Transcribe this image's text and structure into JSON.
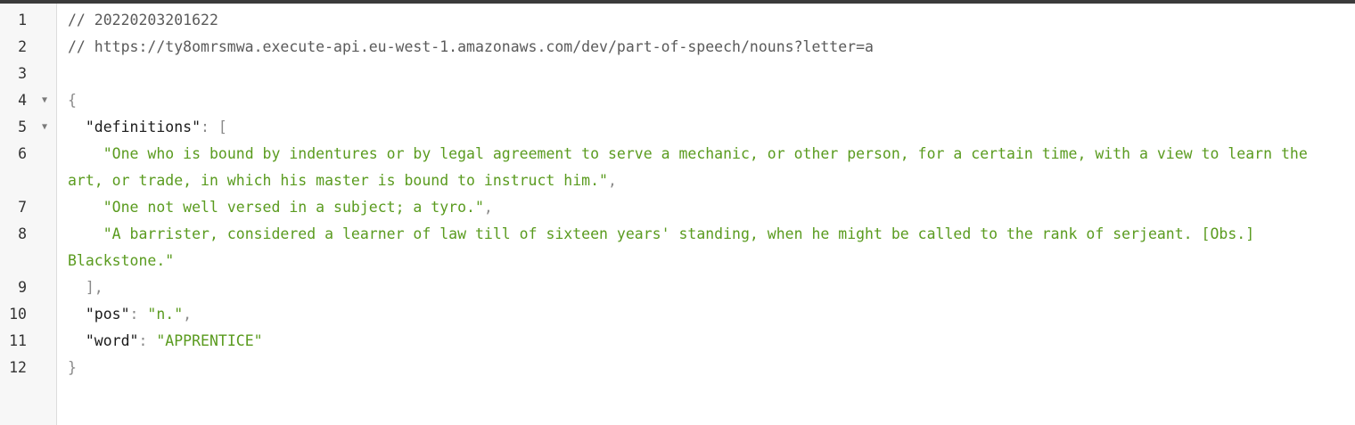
{
  "editor": {
    "lines": {
      "l1": {
        "num": "1",
        "text": "// 20220203201622"
      },
      "l2": {
        "num": "2",
        "text": "// https://ty8omrsmwa.execute-api.eu-west-1.amazonaws.com/dev/part-of-speech/nouns?letter=a"
      },
      "l3": {
        "num": "3"
      },
      "l4": {
        "num": "4",
        "open": "{"
      },
      "l5": {
        "num": "5",
        "indent": "  ",
        "key": "\"definitions\"",
        "sep": ": ",
        "open": "["
      },
      "l6": {
        "num": "6",
        "indent": "    ",
        "value": "\"One who is bound by indentures or by legal agreement to serve a mechanic, or other person, for a certain time, with a view to learn the art, or trade, in which his master is bound to instruct him.\"",
        "comma": ","
      },
      "l7": {
        "num": "7",
        "indent": "    ",
        "value": "\"One not well versed in a subject; a tyro.\"",
        "comma": ","
      },
      "l8": {
        "num": "8",
        "indent": "    ",
        "value": "\"A barrister, considered a learner of law till of sixteen years' standing, when he might be called to the rank of serjeant. [Obs.] Blackstone.\""
      },
      "l9": {
        "num": "9",
        "indent": "  ",
        "close": "],"
      },
      "l10": {
        "num": "10",
        "indent": "  ",
        "key": "\"pos\"",
        "sep": ": ",
        "value": "\"n.\"",
        "comma": ","
      },
      "l11": {
        "num": "11",
        "indent": "  ",
        "key": "\"word\"",
        "sep": ": ",
        "value": "\"APPRENTICE\""
      },
      "l12": {
        "num": "12",
        "close": "}"
      }
    },
    "fold_icon": "triangle-down-icon"
  }
}
